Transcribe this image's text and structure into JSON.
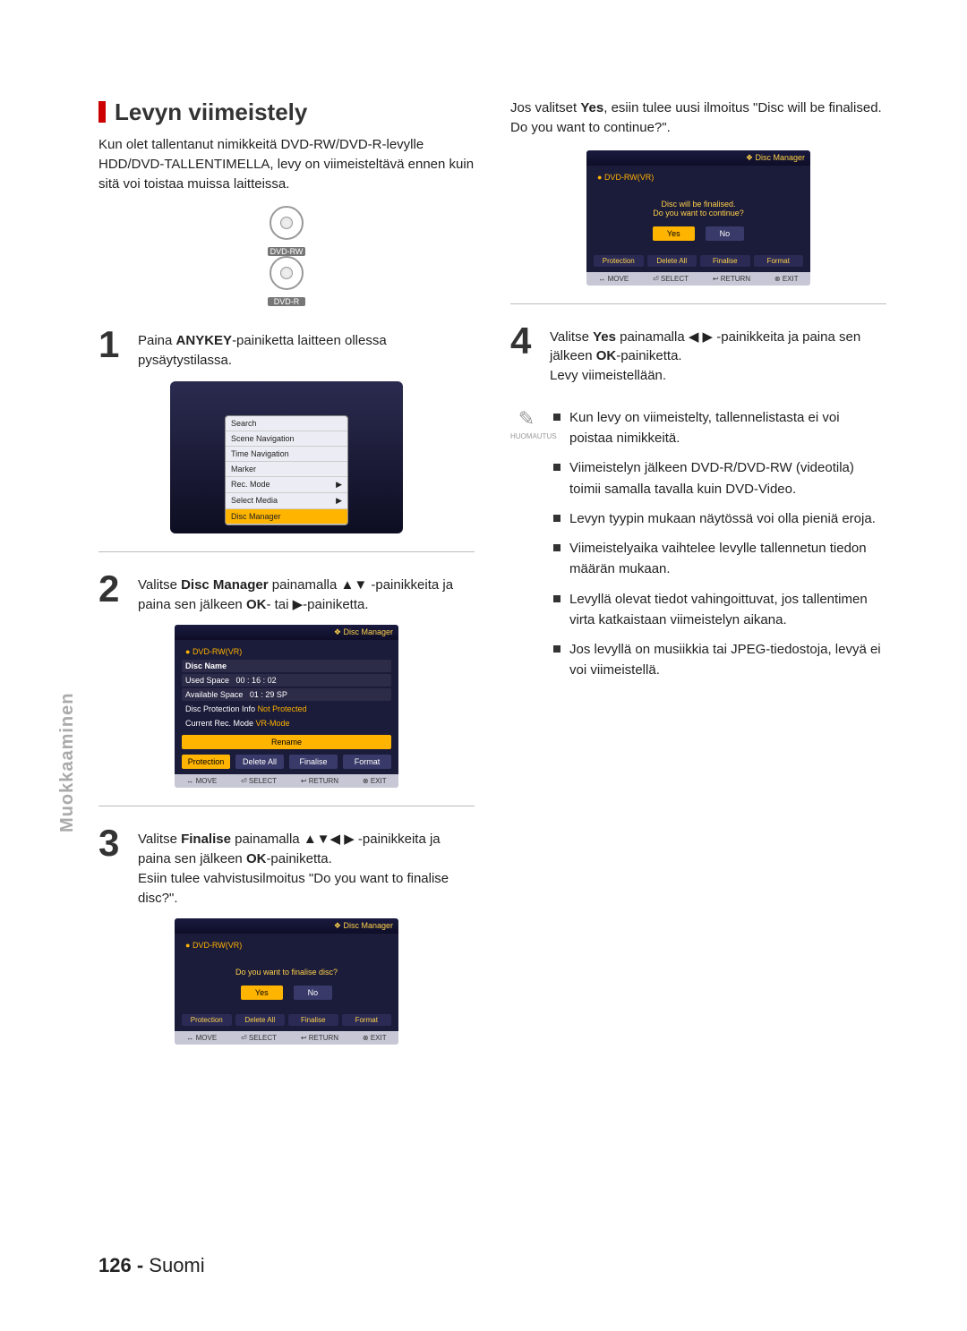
{
  "sidebar_label": "Muokkaaminen",
  "page_number": "126 -",
  "page_lang": "Suomi",
  "section_title": "Levyn viimeistely",
  "intro_text": "Kun olet tallentanut nimikkeitä DVD-RW/DVD-R-levylle HDD/DVD-TALLENTIMELLA, levy on viimeisteltävä ennen kuin sitä voi toistaa muissa laitteissa.",
  "disc_labels": [
    "DVD-RW",
    "DVD-R"
  ],
  "steps": {
    "s1": {
      "num": "1",
      "text_a": "Paina ",
      "b1": "ANYKEY",
      "text_b": "-painiketta laitteen ollessa pysäytystilassa."
    },
    "s2": {
      "num": "2",
      "text_a": "Valitse ",
      "b1": "Disc Manager",
      "text_b": " painamalla ▲▼ -painikkeita ja paina sen jälkeen ",
      "b2": "OK",
      "text_c": "- tai ▶-painiketta."
    },
    "s3": {
      "num": "3",
      "text_a": "Valitse ",
      "b1": "Finalise",
      "text_b": " painamalla ▲▼◀ ▶ -painikkeita ja paina sen jälkeen ",
      "b2": "OK",
      "text_c": "-painiketta.",
      "extra": "Esiin tulee vahvistusilmoitus \"Do you want to finalise disc?\"."
    },
    "s4": {
      "num": "4",
      "text_a": "Valitse ",
      "b1": "Yes",
      "text_b": " painamalla ◀ ▶ -painikkeita ja paina sen jälkeen ",
      "b2": "OK",
      "text_c": "-painiketta.",
      "extra": "Levy viimeistellään."
    }
  },
  "right_intro": "Jos valitset Yes, esiin tulee uusi ilmoitus \"Disc will be finalised. Do you want to continue?\".",
  "note_label": "HUOMAUTUS",
  "notes": [
    "Kun levy on viimeistelty, tallennelistasta ei voi poistaa nimikkeitä.",
    "Viimeistelyn jälkeen DVD-R/DVD-RW (videotila) toimii samalla tavalla kuin DVD-Video.",
    "Levyn tyypin mukaan näytössä voi olla pieniä eroja.",
    "Viimeistelyaika vaihtelee levylle tallennetun tiedon määrän mukaan.",
    "Levyllä olevat tiedot vahingoittuvat, jos tallentimen virta katkaistaan viimeistelyn aikana.",
    "Jos levyllä on musiikkia tai JPEG-tiedostoja, levyä ei voi viimeistellä."
  ],
  "menu_rows": [
    "Search",
    "Scene Navigation",
    "Time Navigation",
    "Marker",
    "Rec. Mode",
    "Select Media",
    "Disc Manager"
  ],
  "dm": {
    "title": "Disc Manager",
    "media": "DVD-RW(VR)",
    "rows": [
      {
        "k": "Disc Name",
        "v": ""
      },
      {
        "k": "Used Space",
        "v": "00 : 16 : 02"
      },
      {
        "k": "Available Space",
        "v": "01 : 29 SP"
      },
      {
        "k": "Disc Protection Info",
        "v": "Not Protected"
      },
      {
        "k": "Current Rec. Mode",
        "v": "VR-Mode"
      }
    ],
    "btns": [
      "Rename",
      "Protection",
      "Delete All",
      "Finalise",
      "Format"
    ],
    "footer": [
      "MOVE",
      "SELECT",
      "RETURN",
      "EXIT"
    ]
  },
  "dialog_finalise": {
    "title": "Disc Manager",
    "media": "DVD-RW(VR)",
    "msg": "Do you want to finalise disc?",
    "yes": "Yes",
    "no": "No",
    "tabs": [
      "Protection",
      "Delete All",
      "Finalise",
      "Format"
    ],
    "footer": [
      "MOVE",
      "SELECT",
      "RETURN",
      "EXIT"
    ]
  },
  "dialog_continue": {
    "title": "Disc Manager",
    "media": "DVD-RW(VR)",
    "msg1": "Disc will be finalised.",
    "msg2": "Do you want to continue?",
    "yes": "Yes",
    "no": "No",
    "tabs": [
      "Protection",
      "Delete All",
      "Finalise",
      "Format"
    ],
    "footer": [
      "MOVE",
      "SELECT",
      "RETURN",
      "EXIT"
    ]
  }
}
